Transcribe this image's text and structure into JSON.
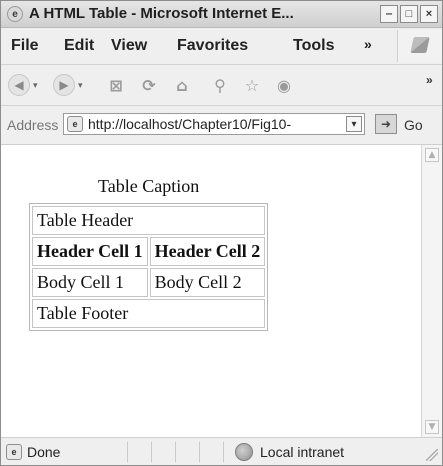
{
  "window": {
    "title": "A HTML Table - Microsoft Internet E...",
    "icon": "ie-icon",
    "controls": [
      "minimize-icon",
      "maximize-icon",
      "close-icon"
    ]
  },
  "menu": {
    "items": [
      "File",
      "Edit",
      "View",
      "Favorites",
      "Tools"
    ],
    "more": "»"
  },
  "toolbar": {
    "buttons": [
      "back-icon",
      "forward-icon",
      "stop-icon",
      "refresh-icon",
      "home-icon",
      "search-icon",
      "favorites-icon",
      "media-icon"
    ],
    "more": "»"
  },
  "address": {
    "label": "Address",
    "value": "http://localhost/Chapter10/Fig10-",
    "go": "Go"
  },
  "content": {
    "caption": "Table Caption",
    "table_header": "Table Header",
    "header_cells": [
      "Header Cell 1",
      "Header Cell 2"
    ],
    "body_cells": [
      "Body Cell 1",
      "Body Cell 2"
    ],
    "footer": "Table Footer"
  },
  "status": {
    "text": "Done",
    "zone": "Local intranet"
  }
}
